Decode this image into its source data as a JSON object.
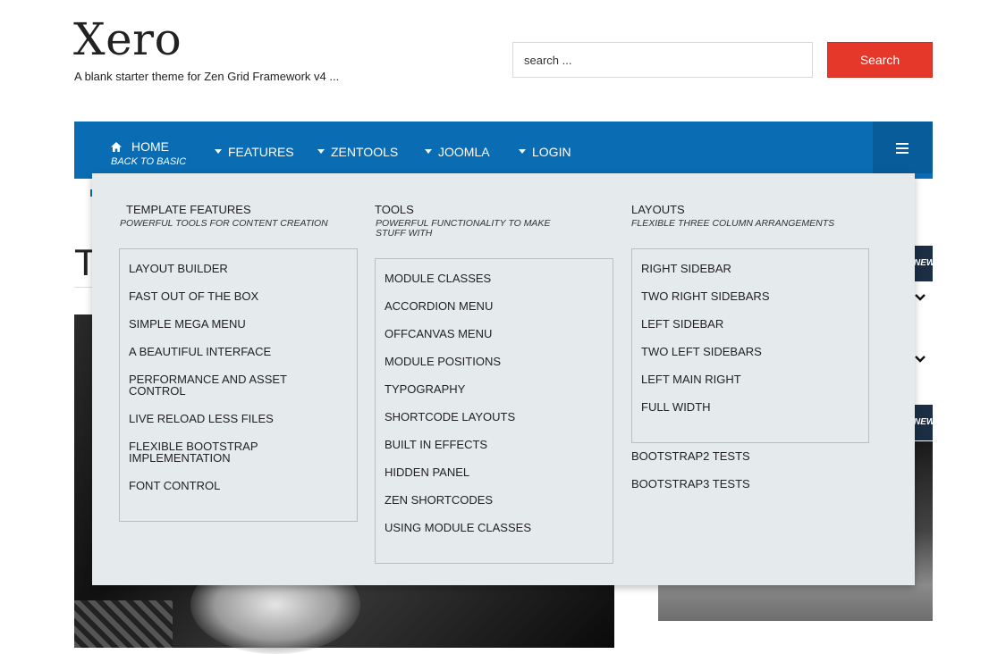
{
  "site": {
    "title": "Xero",
    "tagline": "A blank starter theme for Zen Grid Framework v4 ..."
  },
  "search": {
    "placeholder": "search ...",
    "button_label": "Search"
  },
  "colors": {
    "nav_bg": "#0a6cb3",
    "search_button": "#e6382a",
    "mega_menu_bg": "#e5eaed",
    "badge_bg": "#1b2e44"
  },
  "nav": {
    "home": {
      "label": "Home",
      "sub": "Back to basic",
      "icon": "home-icon"
    },
    "items": [
      {
        "label": "Features"
      },
      {
        "label": "Zentools"
      },
      {
        "label": "Joomla"
      },
      {
        "label": "Login"
      }
    ],
    "menu_toggle_icon": "hamburger-icon"
  },
  "mega_menu": {
    "columns": [
      {
        "title": "Template Features",
        "subtitle": "Powerful tools for content creation",
        "items": [
          "Layout Builder",
          "Fast out of the box",
          "Simple Mega Menu",
          "A Beautiful Interface",
          "Performance and Asset Control",
          "Live Reload Less files",
          "Flexible Bootstrap Implementation",
          "Font Control"
        ]
      },
      {
        "title": "Tools",
        "subtitle": "Powerful functionality to make stuff with",
        "items": [
          "Module classes",
          "Accordion Menu",
          "Offcanvas Menu",
          "Module Positions",
          "Typography",
          "Shortcode Layouts",
          "Built in effects",
          "Hidden Panel",
          "Zen Shortcodes",
          "Using module classes"
        ]
      },
      {
        "title": "Layouts",
        "subtitle": "Flexible three column arrangements",
        "items": [
          "Right Sidebar",
          "Two right sidebars",
          "Left Sidebar",
          "Two left sidebars",
          "Left main right",
          "Full width"
        ],
        "extra_links": [
          "Bootstrap2 tests",
          "Bootstrap3 tests"
        ]
      }
    ]
  },
  "background": {
    "title_partial": "T",
    "badges": [
      "NEW",
      "NEW"
    ]
  }
}
